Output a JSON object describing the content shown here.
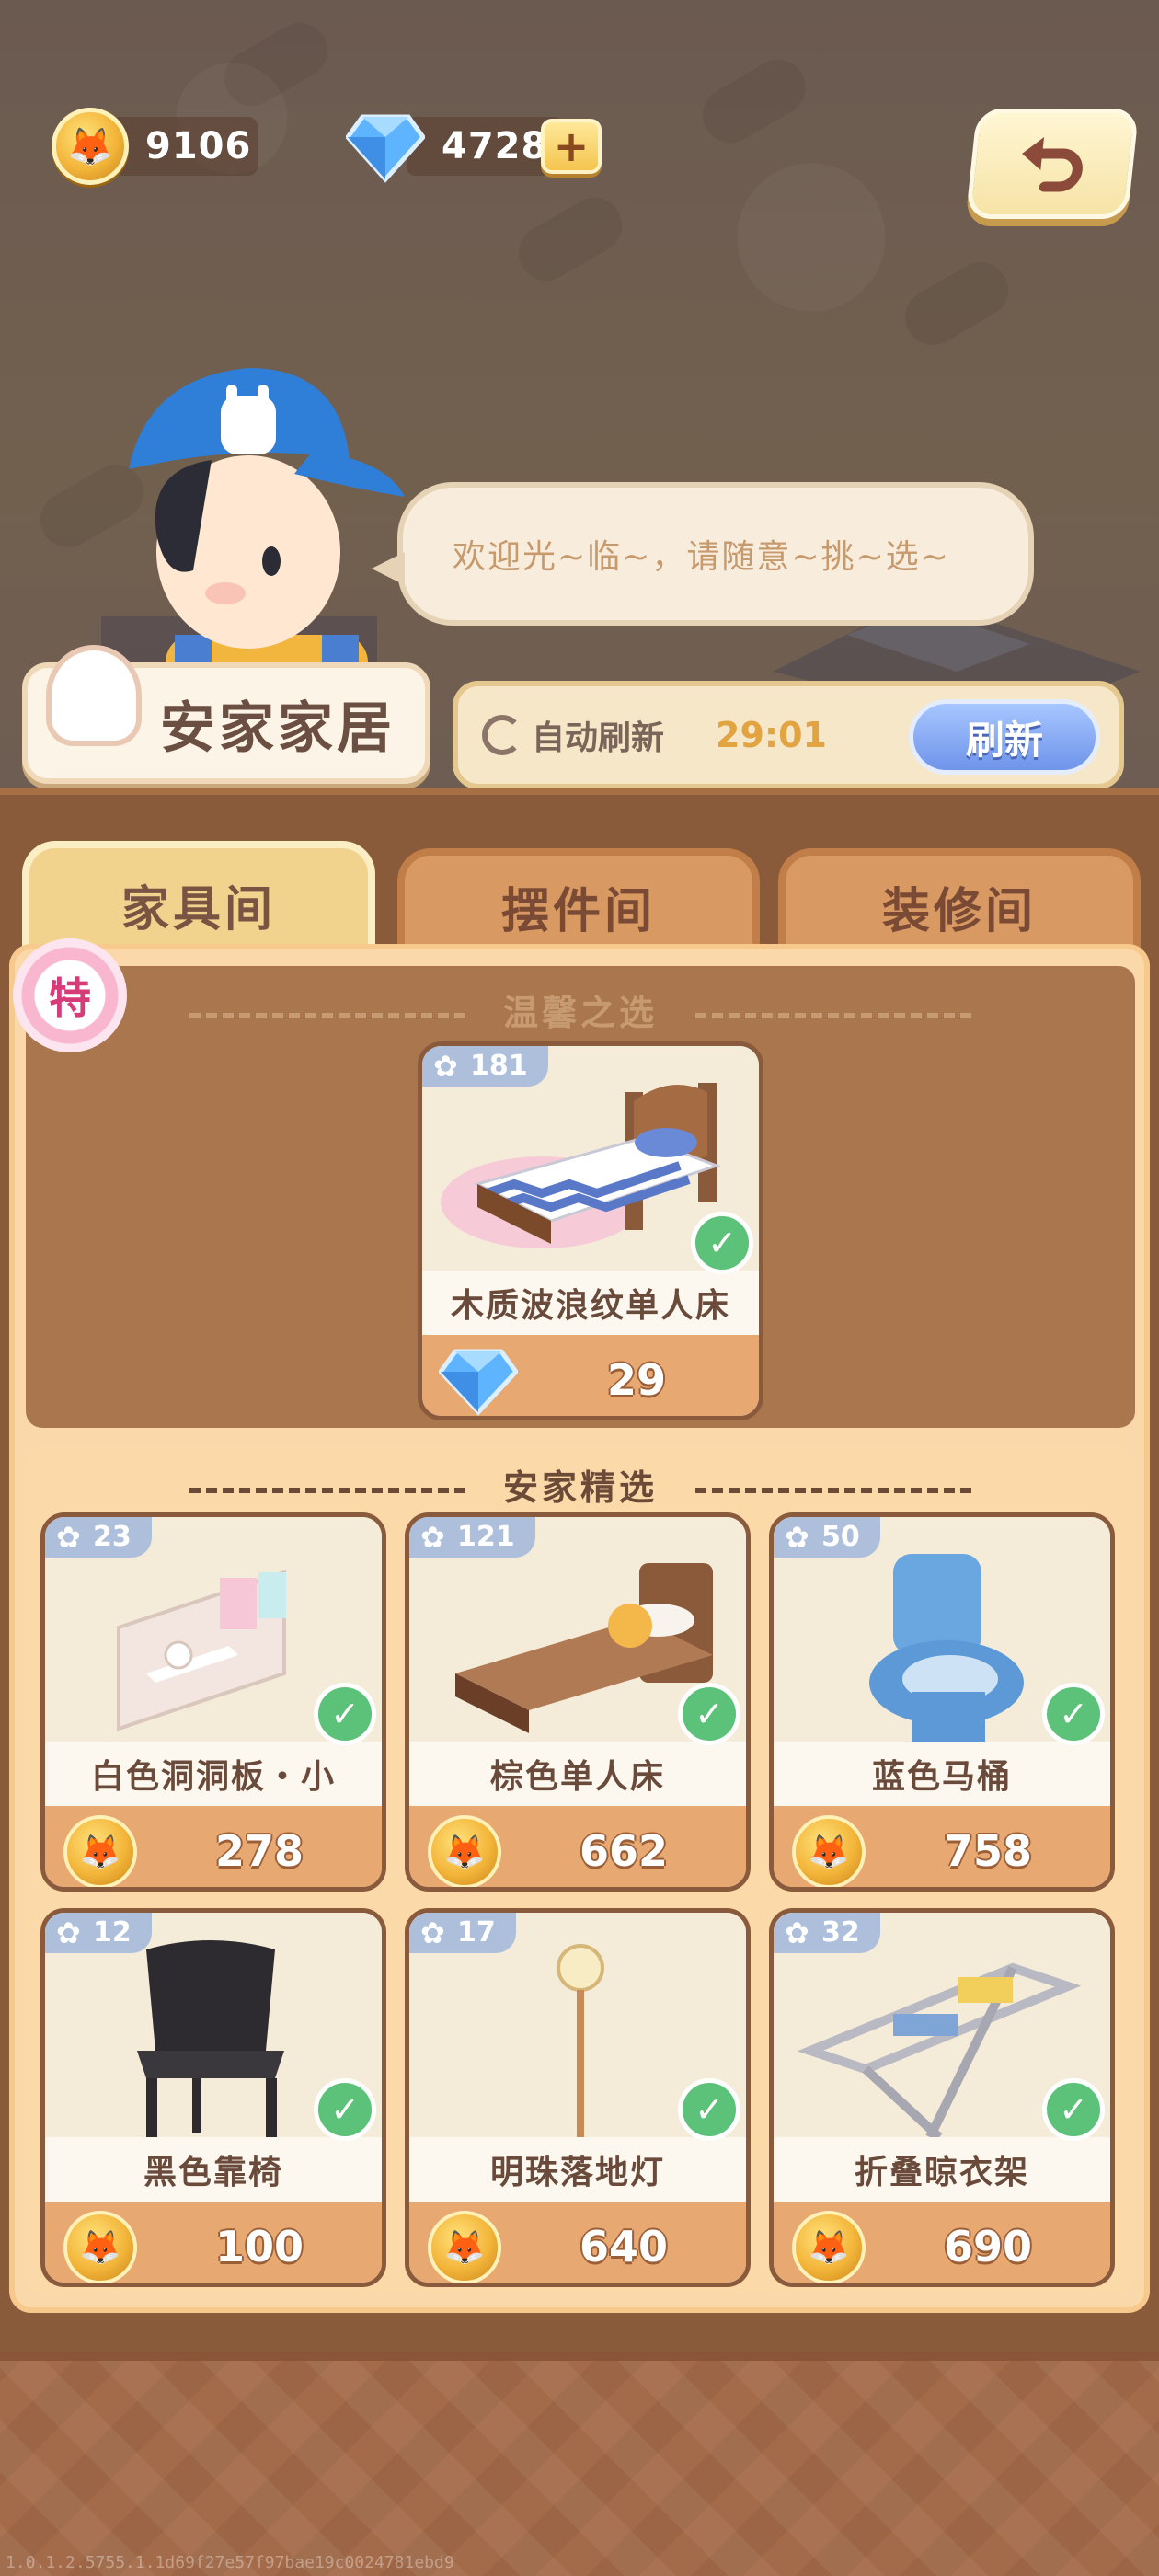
{
  "currency": {
    "coins": "9106",
    "gems": "4728",
    "coin_icon": "fox-coin-icon",
    "gem_icon": "blue-diamond-icon"
  },
  "npc": {
    "greeting": "欢迎光~临~，请随意~挑~选~"
  },
  "shop": {
    "name": "安家家居",
    "auto_refresh_label": "自动刷新",
    "timer": "29:01",
    "refresh_button": "刷新"
  },
  "tabs": [
    {
      "label": "家具间",
      "active": true
    },
    {
      "label": "摆件间",
      "active": false
    },
    {
      "label": "装修间",
      "active": false
    }
  ],
  "featured": {
    "badge": "特",
    "title": "温馨之选",
    "item": {
      "score": "181",
      "name": "木质波浪纹单人床",
      "price": "29",
      "currency": "gem",
      "owned": true
    }
  },
  "selection": {
    "title": "安家精选",
    "items": [
      {
        "score": "23",
        "name": "白色洞洞板・小",
        "price": "278",
        "currency": "coin",
        "owned": true
      },
      {
        "score": "121",
        "name": "棕色单人床",
        "price": "662",
        "currency": "coin",
        "owned": true
      },
      {
        "score": "50",
        "name": "蓝色马桶",
        "price": "758",
        "currency": "coin",
        "owned": true
      },
      {
        "score": "12",
        "name": "黑色靠椅",
        "price": "100",
        "currency": "coin",
        "owned": true
      },
      {
        "score": "17",
        "name": "明珠落地灯",
        "price": "640",
        "currency": "coin",
        "owned": true
      },
      {
        "score": "32",
        "name": "折叠晾衣架",
        "price": "690",
        "currency": "coin",
        "owned": true
      }
    ]
  },
  "colors": {
    "accent_gold": "#f3b53a",
    "refresh_blue": "#6f94ea",
    "owned_green": "#5cc179",
    "panel_brown": "#8a5b3a"
  },
  "build_tag": "1.0.1.2.5755.1.1d69f27e57f97bae19c0024781ebd9"
}
